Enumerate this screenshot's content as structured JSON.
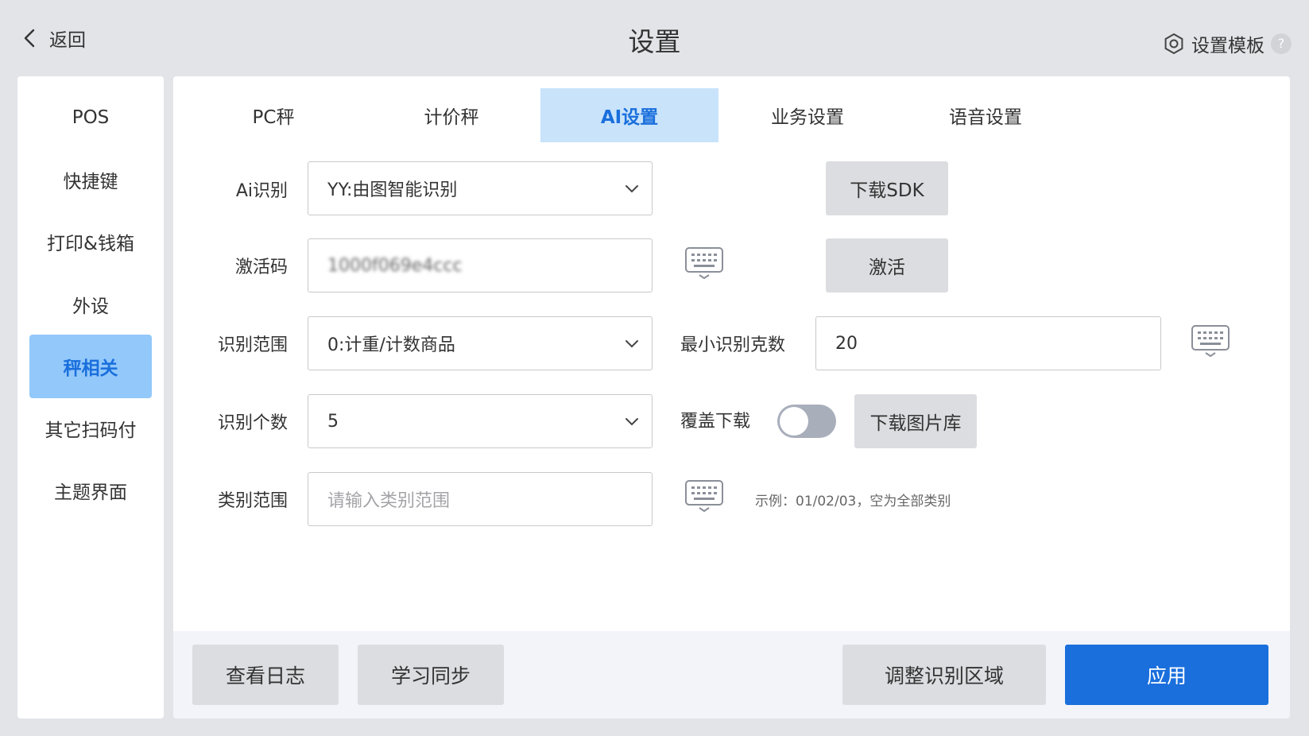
{
  "header": {
    "back_label": "返回",
    "title": "设置",
    "template_label": "设置模板",
    "help_glyph": "?"
  },
  "sidebar": {
    "items": [
      {
        "label": "POS"
      },
      {
        "label": "快捷键"
      },
      {
        "label": "打印&钱箱"
      },
      {
        "label": "外设"
      },
      {
        "label": "秤相关",
        "active": true
      },
      {
        "label": "其它扫码付"
      },
      {
        "label": "主题界面"
      }
    ]
  },
  "tabs": [
    {
      "label": "PC秤"
    },
    {
      "label": "计价秤"
    },
    {
      "label": "AI设置",
      "active": true
    },
    {
      "label": "业务设置"
    },
    {
      "label": "语音设置"
    }
  ],
  "form": {
    "ai_label": "Ai识别",
    "ai_value": "YY:由图智能识别",
    "download_sdk": "下载SDK",
    "code_label": "激活码",
    "code_value": "1000f069e4ccc",
    "activate": "激活",
    "scope_label": "识别范围",
    "scope_value": "0:计重/计数商品",
    "min_weight_label": "最小识别克数",
    "min_weight_value": "20",
    "count_label": "识别个数",
    "count_value": "5",
    "overwrite_label": "覆盖下载",
    "overwrite_on": false,
    "download_gallery": "下载图片库",
    "category_label": "类别范围",
    "category_placeholder": "请输入类别范围",
    "category_value": "",
    "category_hint": "示例：01/02/03，空为全部类别"
  },
  "footer": {
    "view_log": "查看日志",
    "learn_sync": "学习同步",
    "adjust_area": "调整识别区域",
    "apply": "应用"
  },
  "colors": {
    "accent": "#1a6fdc",
    "active_sidebar_bg": "#93c8fa",
    "active_tab_bg": "#c9e3fb",
    "page_bg": "#e3e4e8"
  }
}
